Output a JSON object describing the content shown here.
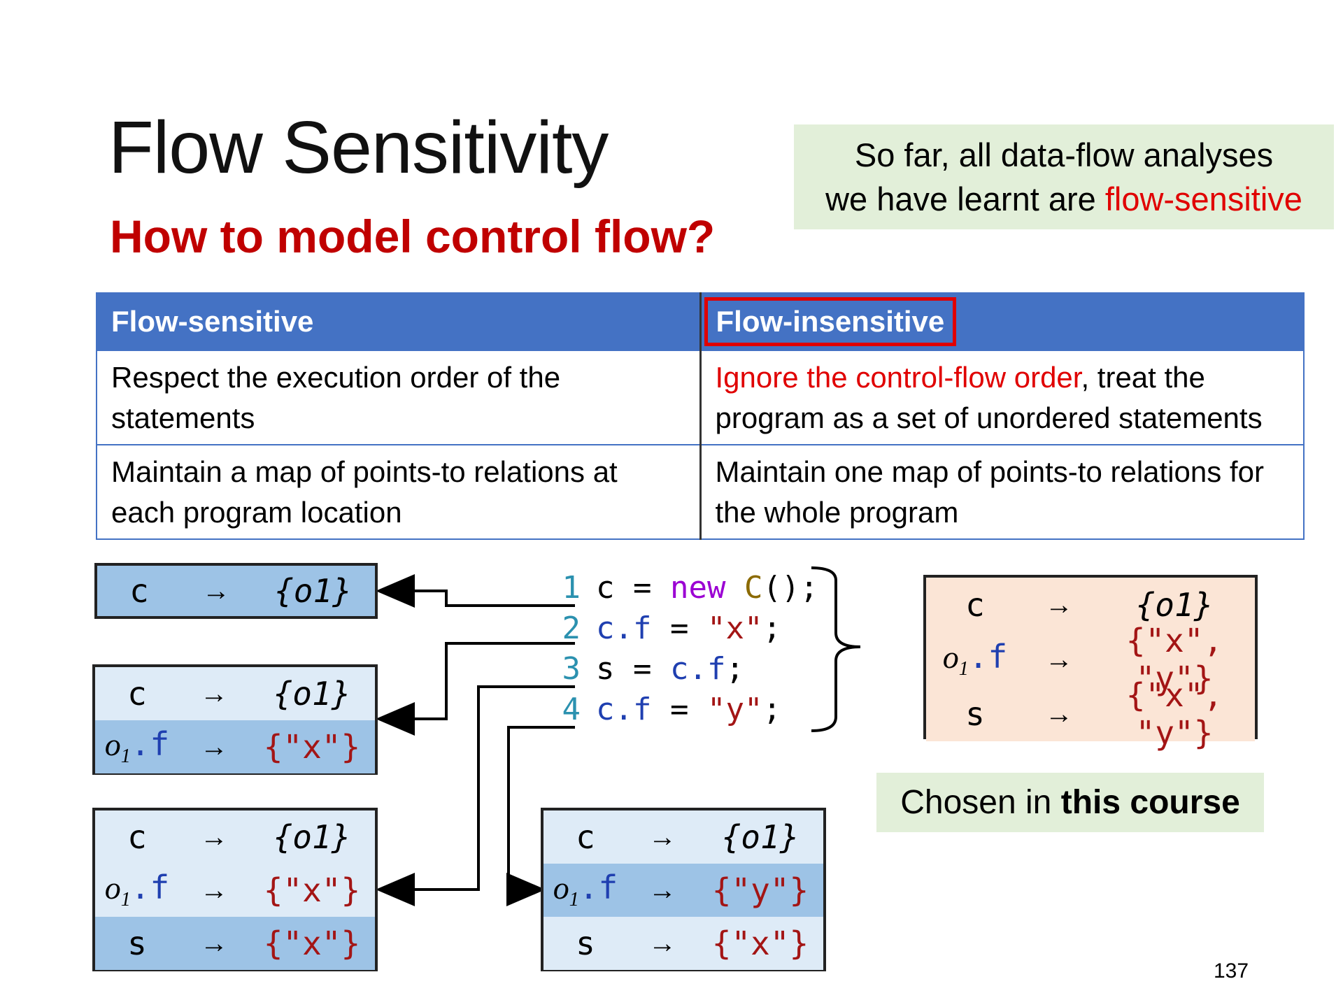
{
  "title": "Flow Sensitivity",
  "subtitle": "How to model control flow?",
  "note": {
    "line1": "So far, all data-flow analyses",
    "line2_prefix": "we have learnt are ",
    "line2_highlight": "flow-sensitive"
  },
  "table": {
    "headers": [
      "Flow-sensitive",
      "Flow-insensitive"
    ],
    "row1": {
      "left": "Respect the execution order of the statements",
      "right_highlight": "Ignore the control-flow order",
      "right_rest": ", treat the program as a set of unordered statements"
    },
    "row2": {
      "left": "Maintain a map of points-to relations at each program location",
      "right": "Maintain one map of points-to relations for the whole program"
    }
  },
  "code": {
    "lines": [
      {
        "num": "1",
        "var": "c",
        "eq": " = ",
        "kw": "new",
        "type": "C",
        "rest": "();"
      },
      {
        "num": "2",
        "var": "c.f",
        "eq": " = ",
        "str": "\"x\"",
        "rest": ";"
      },
      {
        "num": "3",
        "lhs": "s",
        "eq": " = ",
        "var": "c.f",
        "rest": ";"
      },
      {
        "num": "4",
        "var": "c.f",
        "eq": " = ",
        "str": "\"y\"",
        "rest": ";"
      }
    ]
  },
  "symbols": {
    "arrow": "→",
    "obj": "o",
    "obj_sub": "1",
    "field_suffix": ".f",
    "var_c": "c",
    "var_s": "s",
    "set_o1": "{o1}",
    "set_x": "{\"x\"}",
    "set_y": "{\"y\"}",
    "set_xy": "{\"x\", \"y\"}"
  },
  "chosen": {
    "prefix": "Chosen in ",
    "bold": "this course"
  },
  "page_number": "137",
  "colors": {
    "header_blue": "#4472c4",
    "red": "#e00000",
    "dark_red": "#c00000",
    "light_green": "#e2efd9",
    "light_blue": "#deebf7",
    "mid_blue": "#9dc3e6",
    "peach": "#fbe5d6"
  }
}
